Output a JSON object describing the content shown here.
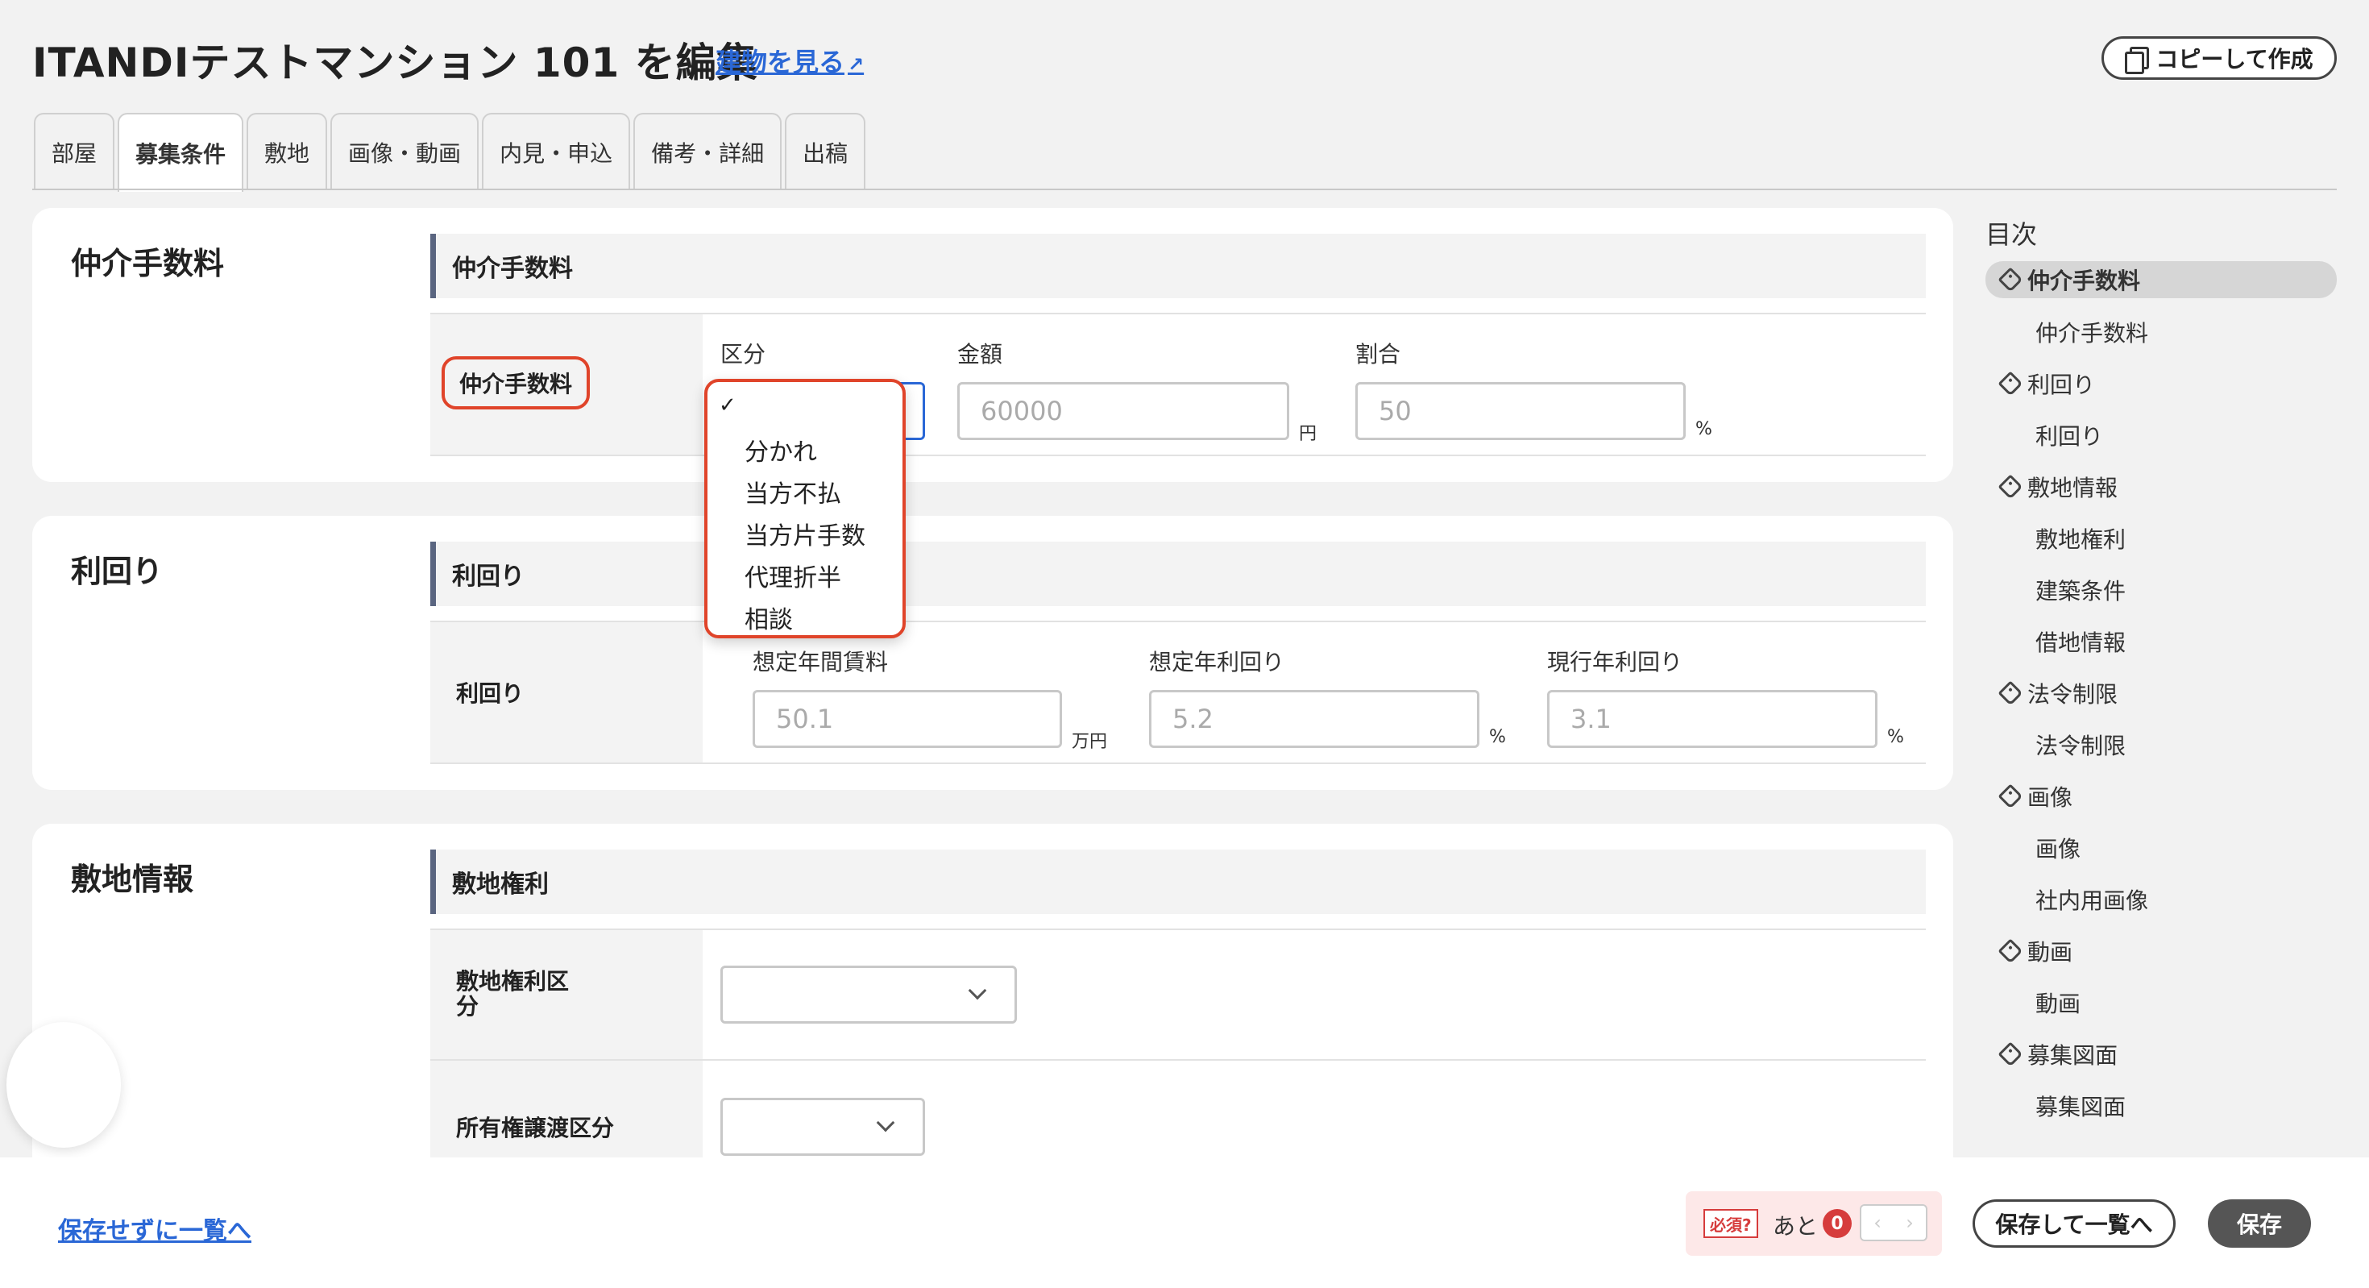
{
  "header": {
    "title": "ITANDIテストマンション 101 を編集",
    "view_building_link": "建物を見る",
    "copy_button": "コピーして作成"
  },
  "tabs": [
    {
      "label": "部屋"
    },
    {
      "label": "募集条件"
    },
    {
      "label": "敷地"
    },
    {
      "label": "画像・動画"
    },
    {
      "label": "内見・申込"
    },
    {
      "label": "備考・詳細"
    },
    {
      "label": "出稿"
    }
  ],
  "brokerage": {
    "card_title": "仲介手数料",
    "section_title": "仲介手数料",
    "row_label": "仲介手数料",
    "type_label": "区分",
    "amount_label": "金額",
    "amount_placeholder": "60000",
    "amount_unit": "円",
    "ratio_label": "割合",
    "ratio_placeholder": "50",
    "ratio_unit": "%",
    "dropdown": {
      "selected_mark": "✓",
      "options": [
        "分かれ",
        "当方不払",
        "当方片手数",
        "代理折半",
        "相談"
      ]
    }
  },
  "yield": {
    "card_title": "利回り",
    "section_title": "利回り",
    "row_label": "利回り",
    "annual_rent_label": "想定年間賃料",
    "annual_rent_placeholder": "50.1",
    "annual_rent_unit": "万円",
    "expected_yield_label": "想定年利回り",
    "expected_yield_placeholder": "5.2",
    "expected_yield_unit": "%",
    "current_yield_label": "現行年利回り",
    "current_yield_placeholder": "3.1",
    "current_yield_unit": "%"
  },
  "site": {
    "card_title": "敷地情報",
    "section_title": "敷地権利",
    "row1_label_line1": "敷地権利区",
    "row1_label_line2": "分",
    "row2_label": "所有権譲渡区分"
  },
  "toc": {
    "title": "目次",
    "items": [
      {
        "label": "仲介手数料",
        "level": 1
      },
      {
        "label": "仲介手数料",
        "level": 2
      },
      {
        "label": "利回り",
        "level": 1
      },
      {
        "label": "利回り",
        "level": 2
      },
      {
        "label": "敷地情報",
        "level": 1
      },
      {
        "label": "敷地権利",
        "level": 2
      },
      {
        "label": "建築条件",
        "level": 2
      },
      {
        "label": "借地情報",
        "level": 2
      },
      {
        "label": "法令制限",
        "level": 1
      },
      {
        "label": "法令制限",
        "level": 2
      },
      {
        "label": "画像",
        "level": 1
      },
      {
        "label": "画像",
        "level": 2
      },
      {
        "label": "社内用画像",
        "level": 2
      },
      {
        "label": "動画",
        "level": 1
      },
      {
        "label": "動画",
        "level": 2
      },
      {
        "label": "募集図面",
        "level": 1
      },
      {
        "label": "募集図面",
        "level": 2
      }
    ]
  },
  "footer": {
    "back_link": "保存せずに一覧へ",
    "required_badge": "必須?",
    "remaining_text": "あと",
    "remaining_count": "0",
    "prev_glyph": "‹",
    "next_glyph": "›",
    "save_and_list_button": "保存して一覧へ",
    "save_button": "保存"
  },
  "colors": {
    "link": "#2a67d6",
    "highlight": "#e0442a",
    "section_accent": "#5a6580",
    "required": "#d63c3c"
  }
}
